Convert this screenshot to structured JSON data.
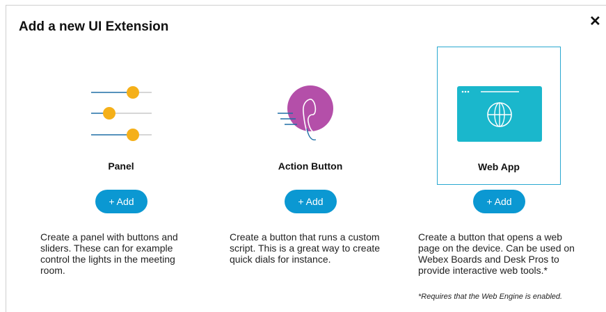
{
  "dialog": {
    "title": "Add a new UI Extension",
    "close_label": "✕"
  },
  "options": [
    {
      "label": "Panel",
      "add_label": "+ Add",
      "description": "Create a panel with buttons and sliders. These can for example control the lights in the meeting room.",
      "icon": "sliders-icon"
    },
    {
      "label": "Action Button",
      "add_label": "+ Add",
      "description": "Create a button that runs a custom script. This is a great way to create quick dials for instance.",
      "icon": "phone-call-icon"
    },
    {
      "label": "Web App",
      "add_label": "+ Add",
      "description": "Create a button that opens a web page on the device. Can be used on Webex Boards and Desk Pros to provide interactive web tools.*",
      "icon": "web-browser-icon",
      "selected": true
    }
  ],
  "footnote": "*Requires that the Web Engine is enabled.",
  "colors": {
    "accent_button": "#0b98d2",
    "selected_border": "#29a8d0",
    "slider_knob": "#f5b019",
    "slider_track": "#1f6fa6",
    "action_circle": "#b44fa9",
    "webapp_card": "#1ab7cc"
  }
}
